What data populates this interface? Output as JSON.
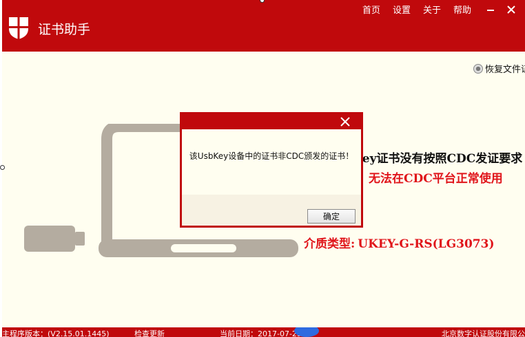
{
  "app": {
    "title": "证书助手"
  },
  "menu": {
    "home": "首页",
    "settings": "设置",
    "about": "关于",
    "help": "帮助"
  },
  "restore": {
    "label": "恢复文件证书"
  },
  "message": {
    "line1": "key证书没有按照CDC发证要求",
    "line2": "，无法在CDC平台正常使用"
  },
  "media": {
    "label": "介质类型:",
    "value": "UKEY-G-RS(LG3073)"
  },
  "dialog": {
    "message": "该UsbKey设备中的证书非CDC颁发的证书！",
    "ok_label": "确定"
  },
  "status": {
    "version": "主程序版本：(V2.15.01.1445)",
    "check_update": "检查更新",
    "date": "当前日期：2017-07-25",
    "company": "北京数字认证股份有限公司"
  },
  "colors": {
    "brand_red": "#c0090c",
    "alert_red": "#e0141a",
    "device_gray": "#b4aca0",
    "background": "#fffef0"
  }
}
